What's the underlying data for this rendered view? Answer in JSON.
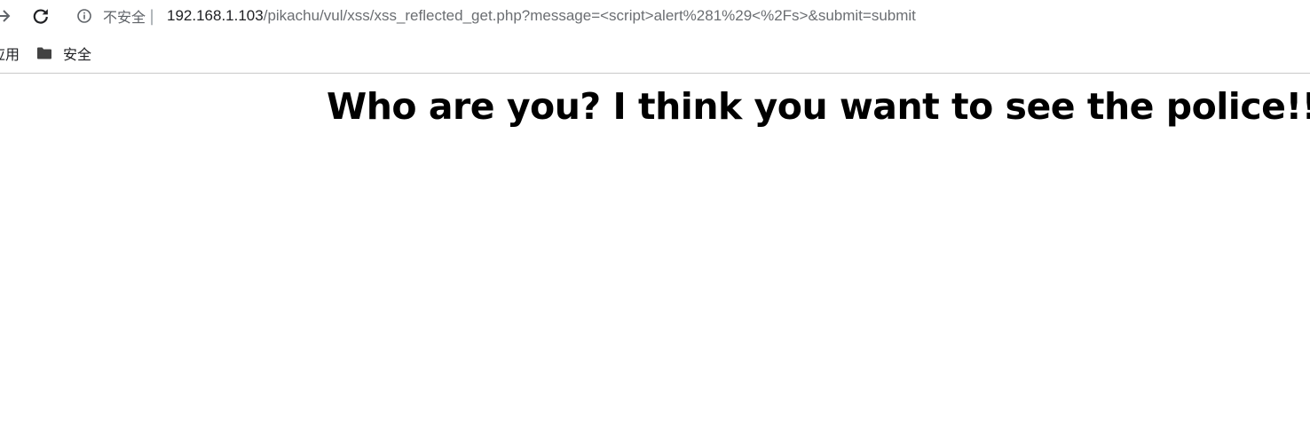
{
  "toolbar": {
    "forward_icon": "arrow-right-icon",
    "reload_icon": "reload-icon",
    "security": {
      "icon": "info-circle-icon",
      "label": "不安全",
      "separator": "|"
    },
    "url": {
      "host": "192.168.1.103",
      "path": "/pikachu/vul/xss/xss_reflected_get.php?message=<script>alert%281%29<%2Fs>&submit=submit"
    }
  },
  "bookmarks_bar": {
    "items": [
      {
        "label": "应用",
        "icon": "apps-icon"
      },
      {
        "label": "安全",
        "icon": "folder-icon"
      }
    ]
  },
  "page": {
    "heading": "Who are you? I think you want to see the police!!."
  }
}
